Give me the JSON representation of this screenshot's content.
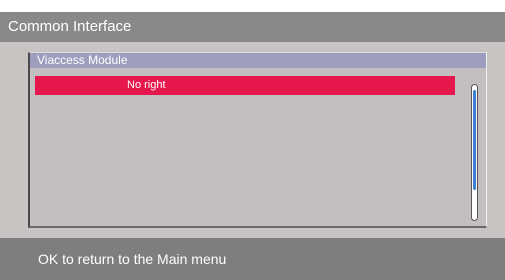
{
  "window": {
    "title": "Common Interface"
  },
  "module": {
    "header": "Viaccess Module",
    "items": [
      {
        "label": "No right",
        "selected": true
      }
    ]
  },
  "footer": {
    "hint": "OK to return to the Main menu"
  },
  "colors": {
    "title_bar": "#898989",
    "panel_header": "#9f9dbd",
    "selected_row": "#e6174d",
    "scroll_thumb": "#3d7fd6",
    "footer_bar": "#7e7e7e"
  }
}
